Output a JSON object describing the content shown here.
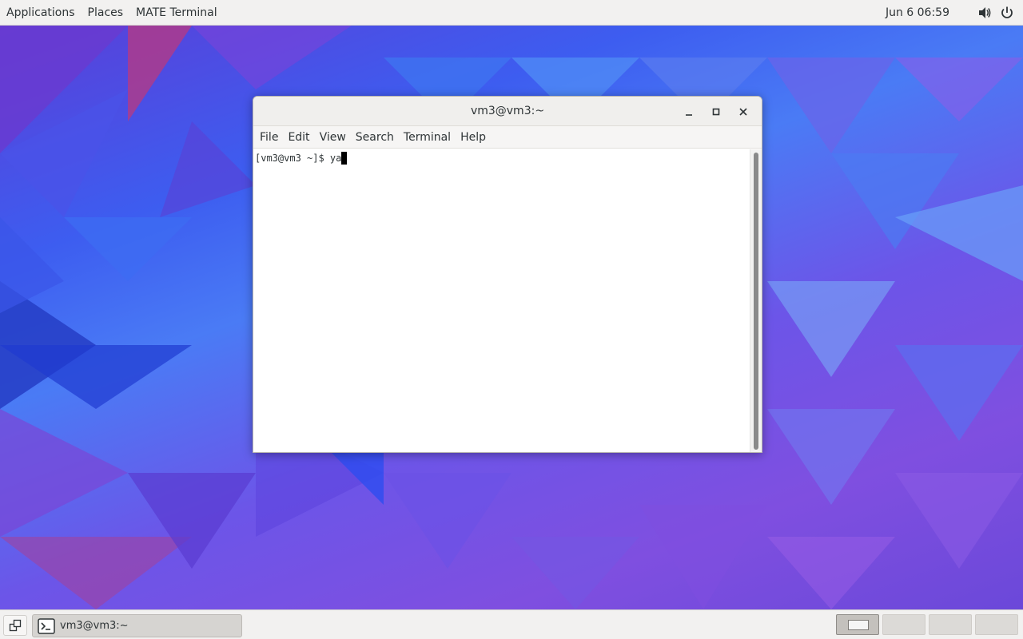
{
  "top_panel": {
    "menus": [
      "Applications",
      "Places",
      "MATE Terminal"
    ],
    "clock": "Jun 6  06:59",
    "tray": [
      "volume-icon",
      "power-icon"
    ]
  },
  "window": {
    "title": "vm3@vm3:~",
    "menu": [
      "File",
      "Edit",
      "View",
      "Search",
      "Terminal",
      "Help"
    ],
    "terminal": {
      "prompt": "[vm3@vm3 ~]$ ",
      "input": "ya"
    }
  },
  "bottom_panel": {
    "task_label": "vm3@vm3:~",
    "workspaces": 4,
    "active_workspace": 1
  }
}
